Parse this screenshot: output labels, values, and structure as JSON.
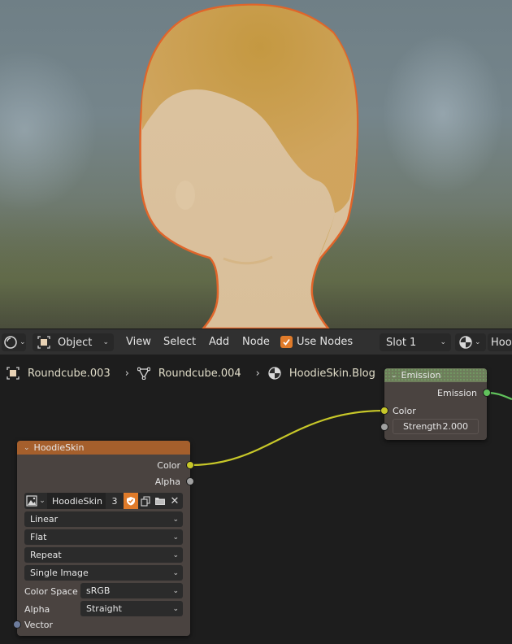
{
  "viewport": {
    "description": "3D viewport render of a stylized head mesh with hair texture, selected with orange outline"
  },
  "header": {
    "editor_type_icon": "node-editor-icon",
    "mode": "Object",
    "menus": [
      "View",
      "Select",
      "Add",
      "Node"
    ],
    "use_nodes_label": "Use Nodes",
    "use_nodes_checked": true,
    "slot": "Slot 1",
    "shader_type_icon": "material-icon",
    "material_name_truncated": "Hoo"
  },
  "breadcrumb": [
    {
      "icon": "object-icon",
      "label": "Roundcube.003"
    },
    {
      "icon": "mesh-icon",
      "label": "Roundcube.004"
    },
    {
      "icon": "material-icon",
      "label": "HoodieSkin.Blog"
    }
  ],
  "colors": {
    "selection_outline": "#e0652a",
    "accent_orange": "#e07b2a",
    "image_node_header": "#a55f2c",
    "shader_node_header": "#6e7d5b",
    "socket_color": "#c7c729",
    "socket_float": "#a1a1a1",
    "socket_shader": "#61c25c",
    "socket_vector": "#6d7c9c"
  },
  "emission_node": {
    "title": "Emission",
    "outputs": [
      {
        "label": "Emission",
        "type": "shader"
      }
    ],
    "inputs": [
      {
        "label": "Color",
        "type": "color"
      },
      {
        "label": "Strength",
        "type": "float",
        "value": "2.000"
      }
    ]
  },
  "image_node": {
    "title": "HoodieSkin",
    "outputs": [
      {
        "label": "Color",
        "type": "color"
      },
      {
        "label": "Alpha",
        "type": "float"
      }
    ],
    "image": {
      "name": "HoodieSkin",
      "users": "3",
      "fake_user": true
    },
    "interpolation": "Linear",
    "projection": "Flat",
    "extension": "Repeat",
    "source": "Single Image",
    "color_space_label": "Color Space",
    "color_space": "sRGB",
    "alpha_label": "Alpha",
    "alpha": "Straight",
    "inputs": [
      {
        "label": "Vector",
        "type": "vector"
      }
    ]
  }
}
